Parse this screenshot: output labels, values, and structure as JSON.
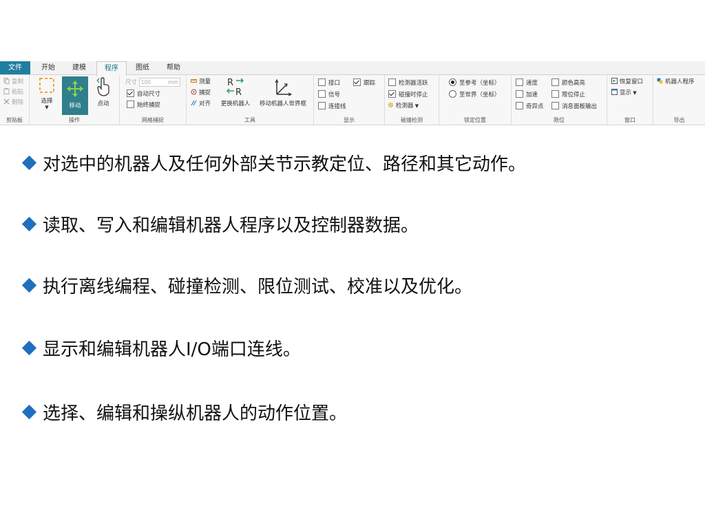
{
  "ribbon": {
    "tabs": [
      "文件",
      "开始",
      "建模",
      "程序",
      "图纸",
      "帮助"
    ],
    "clipboard": {
      "items": [
        "复制",
        "粘贴",
        "删除"
      ],
      "label": "剪贴板"
    },
    "operation": {
      "select": "选择",
      "move": "移动",
      "point": "点动",
      "label": "操作"
    },
    "grid": {
      "size_label": "尺寸",
      "size_value": "100",
      "size_unit": "mm",
      "auto_size": "自动尺寸",
      "always_snap": "始终捕捉",
      "label": "网格捕捉"
    },
    "tools": {
      "measure": "测量",
      "snap": "捕捉",
      "align": "对齐",
      "swap_robot": "更换机器人",
      "move_world_frame": "移动机器人世界框",
      "label": "工具"
    },
    "display": {
      "interface": "接口",
      "signal": "信号",
      "wire": "连接线",
      "trace": "跟踪",
      "label": "显示"
    },
    "collision": {
      "detector_active": "检测器活跃",
      "stop_on_collision": "碰撞时停止",
      "detector": "检测器",
      "label": "碰撞检测"
    },
    "lock": {
      "to_reference": "至参考（坐标）",
      "to_world": "至世界（坐标）",
      "label": "锁定位置"
    },
    "limits": {
      "speed": "速度",
      "accel": "加速",
      "singular": "奇异点",
      "color_highlight": "颜色高亮",
      "limit_stop": "限位停止",
      "msg_panel_output": "消息面板输出",
      "label": "限位"
    },
    "window": {
      "restore": "恢复窗口",
      "show": "显示",
      "label": "窗口"
    },
    "export": {
      "robot_program": "机器人程序",
      "label": "导出"
    }
  },
  "bullets": [
    "对选中的机器人及任何外部关节示教定位、路径和其它动作。",
    "读取、写入和编辑机器人程序以及控制器数据。",
    "执行离线编程、碰撞检测、限位测试、校准以及优化。",
    "显示和编辑机器人I/O端口连线。",
    "选择、编辑和操纵机器人的动作位置。"
  ],
  "colors": {
    "file_tab": "#1f7fa0",
    "selected_button": "#2f7f8c",
    "bullet": "#1f6fbf"
  }
}
